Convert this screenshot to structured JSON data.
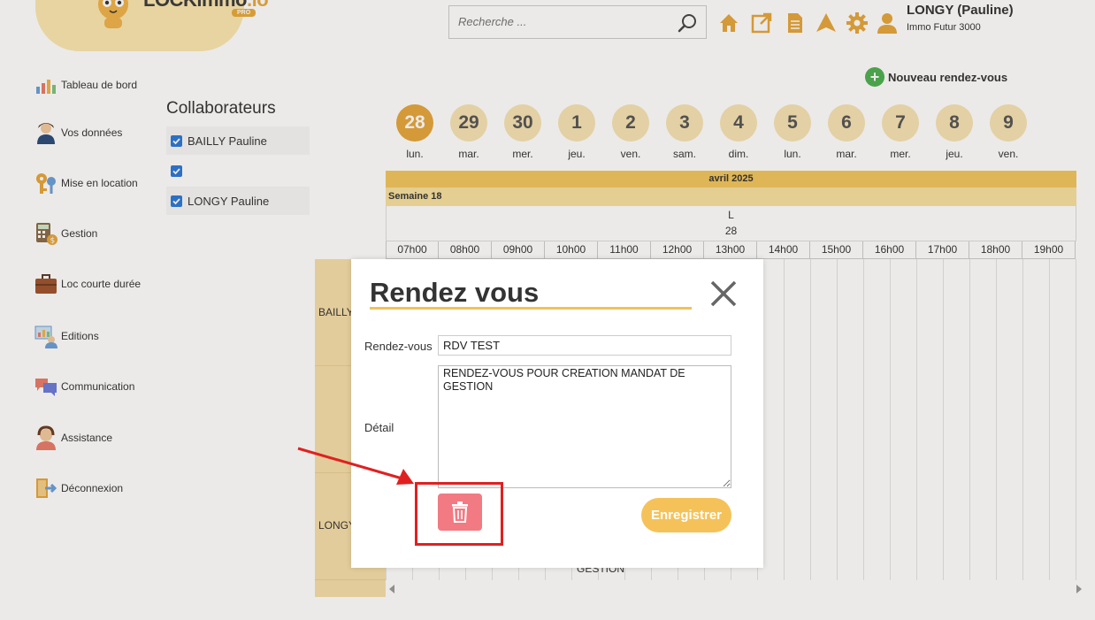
{
  "header": {
    "logo": {
      "name": "LOCKimmo",
      "suffix": ".io",
      "badge": "PRO"
    },
    "search": {
      "placeholder": "Recherche ..."
    },
    "icons": [
      "home-icon",
      "external-link-icon",
      "document-icon",
      "send-icon",
      "settings-icon",
      "user-icon"
    ],
    "user": {
      "name": "LONGY (Pauline)",
      "company": "Immo Futur 3000"
    }
  },
  "sidebar": {
    "items": [
      {
        "label": "Tableau de bord",
        "icon": "dashboard-icon"
      },
      {
        "label": "Vos données",
        "icon": "person-icon"
      },
      {
        "label": "Mise en location",
        "icon": "keys-icon"
      },
      {
        "label": "Gestion",
        "icon": "calculator-icon"
      },
      {
        "label": "Loc courte durée",
        "icon": "suitcase-icon"
      },
      {
        "label": "Editions",
        "icon": "editions-icon"
      },
      {
        "label": "Communication",
        "icon": "chat-icon"
      },
      {
        "label": "Assistance",
        "icon": "support-icon"
      },
      {
        "label": "Déconnexion",
        "icon": "logout-icon"
      }
    ]
  },
  "collaborators": {
    "title": "Collaborateurs",
    "items": [
      {
        "label": "BAILLY Pauline",
        "checked": true
      },
      {
        "label": "",
        "checked": true
      },
      {
        "label": "LONGY Pauline",
        "checked": true
      }
    ]
  },
  "new_appointment": {
    "label": "Nouveau rendez-vous"
  },
  "days": [
    {
      "num": "28",
      "label": "lun.",
      "active": true
    },
    {
      "num": "29",
      "label": "mar."
    },
    {
      "num": "30",
      "label": "mer."
    },
    {
      "num": "1",
      "label": "jeu."
    },
    {
      "num": "2",
      "label": "ven."
    },
    {
      "num": "3",
      "label": "sam."
    },
    {
      "num": "4",
      "label": "dim."
    },
    {
      "num": "5",
      "label": "lun."
    },
    {
      "num": "6",
      "label": "mar."
    },
    {
      "num": "7",
      "label": "mer."
    },
    {
      "num": "8",
      "label": "jeu."
    },
    {
      "num": "9",
      "label": "ven."
    }
  ],
  "calendar": {
    "month": "avril 2025",
    "week": "Semaine 18",
    "day_letter": "L",
    "day_number": "28",
    "hours": [
      "07h00",
      "08h00",
      "09h00",
      "10h00",
      "11h00",
      "12h00",
      "13h00",
      "14h00",
      "15h00",
      "16h00",
      "17h00",
      "18h00",
      "19h00"
    ],
    "resources": [
      "BAILLY",
      "LONGY"
    ],
    "event_peek": "GESTION"
  },
  "modal": {
    "title": "Rendez vous",
    "rdv_label": "Rendez-vous",
    "rdv_value": "RDV TEST",
    "detail_label": "Détail",
    "detail_value": "RENDEZ-VOUS POUR CREATION MANDAT DE GESTION",
    "save_label": "Enregistrer"
  },
  "colors": {
    "accent": "#f5c25a",
    "accent_dark": "#e6a53c",
    "delete": "#f27a82",
    "annotation": "#e02020"
  }
}
